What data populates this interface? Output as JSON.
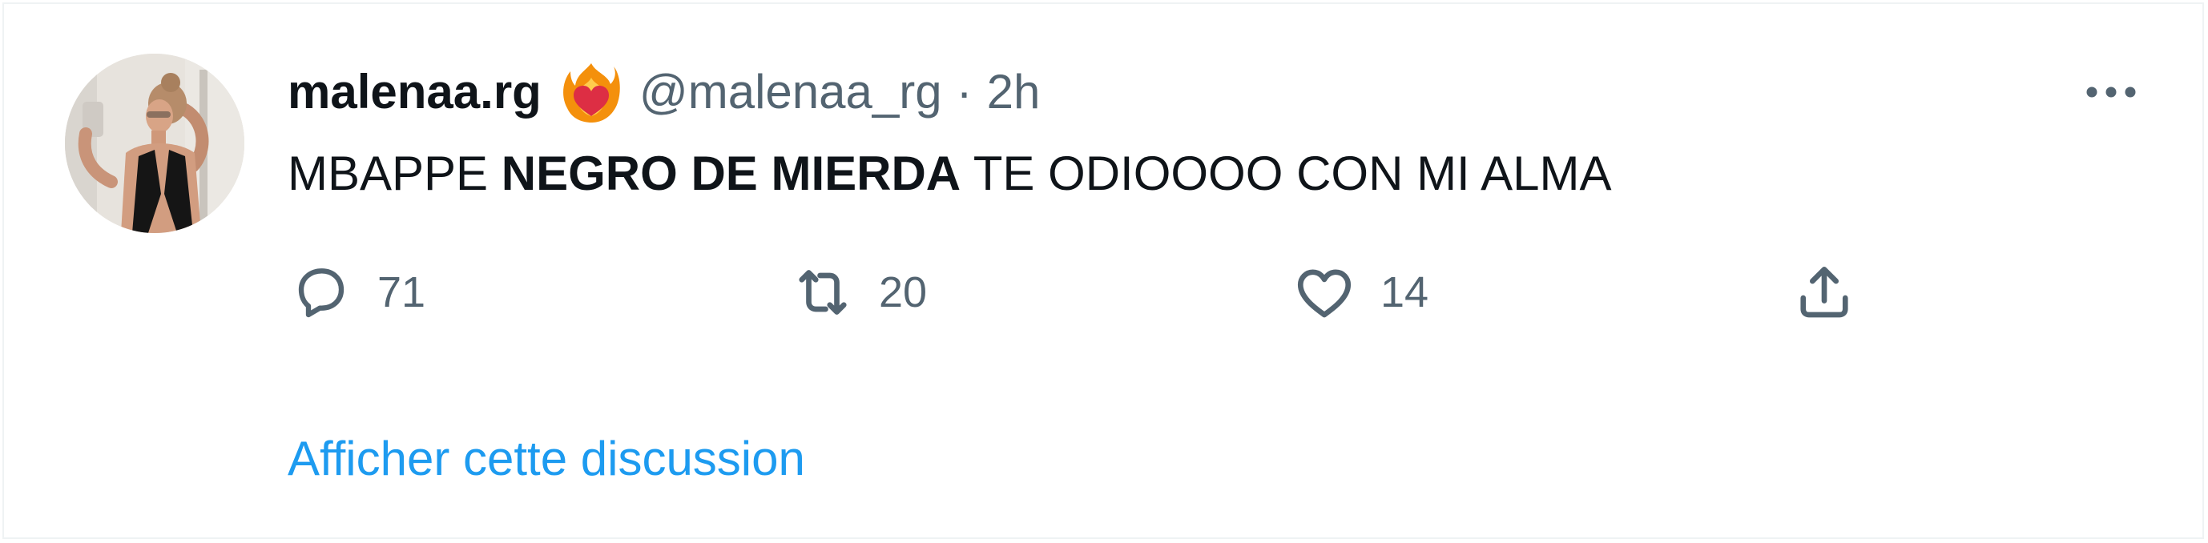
{
  "tweet": {
    "author_name": "malenaa.rg",
    "author_badge": "heart-on-fire-emoji",
    "handle": "@malenaa_rg",
    "separator": "·",
    "time": "2h",
    "text_before": "MBAPPE ",
    "text_bold": "NEGRO DE MIERDA",
    "text_after": " TE ODIOOOO CON MI ALMA",
    "more_icon": "more-horizontal-icon"
  },
  "actions": {
    "reply_icon": "reply-icon",
    "reply_count": "71",
    "retweet_icon": "retweet-icon",
    "retweet_count": "20",
    "like_icon": "heart-icon",
    "like_count": "14",
    "share_icon": "share-icon"
  },
  "show_thread_label": "Afficher cette discussion",
  "colors": {
    "text_primary": "#0f1419",
    "text_secondary": "#536471",
    "link": "#1d9bf0",
    "border": "#eff3f4"
  }
}
